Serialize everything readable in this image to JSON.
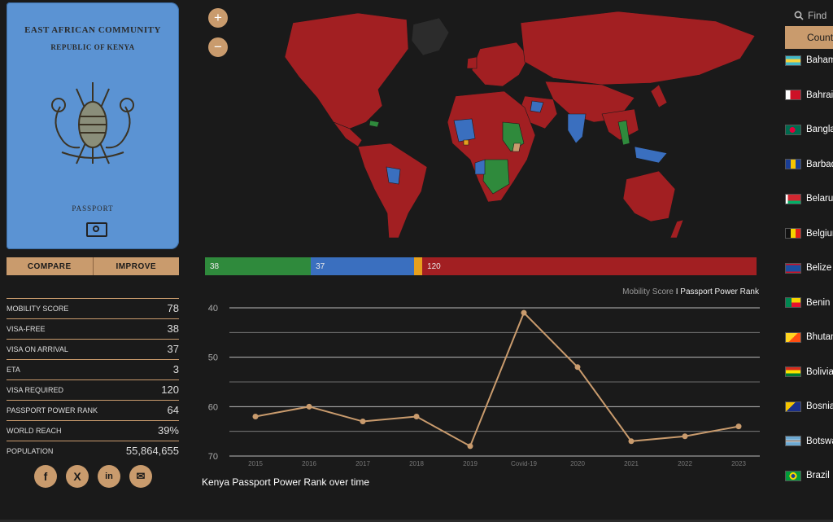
{
  "passport": {
    "line1": "EAST AFRICAN COMMUNITY",
    "line2": "REPUBLIC OF KENYA",
    "label": "PASSPORT",
    "cover_color": "#5b93d3"
  },
  "actions": {
    "compare": "COMPARE",
    "improve": "IMPROVE"
  },
  "stats": [
    {
      "label": "MOBILITY SCORE",
      "value": "78"
    },
    {
      "label": "VISA-FREE",
      "value": "38"
    },
    {
      "label": "VISA ON ARRIVAL",
      "value": "37"
    },
    {
      "label": "ETA",
      "value": "3"
    },
    {
      "label": "VISA REQUIRED",
      "value": "120"
    },
    {
      "label": "PASSPORT POWER RANK",
      "value": "64"
    },
    {
      "label": "WORLD REACH",
      "value": "39%"
    },
    {
      "label": "POPULATION",
      "value": "55,864,655"
    }
  ],
  "social": [
    "facebook-icon",
    "x-icon",
    "linkedin-icon",
    "email-icon"
  ],
  "zoom": {
    "in": "+",
    "out": "−"
  },
  "breakdown": [
    {
      "label": "38",
      "value": 38,
      "color": "#2f8a3c"
    },
    {
      "label": "37",
      "value": 37,
      "color": "#3a6fbf"
    },
    {
      "label": "",
      "value": 3,
      "color": "#e6a01e"
    },
    {
      "label": "120",
      "value": 120,
      "color": "#a21f22"
    }
  ],
  "legend": {
    "a": "Mobility Score",
    "sep": "I",
    "b": "Passport Power Rank"
  },
  "chart_data": {
    "type": "line",
    "x": [
      "2015",
      "2016",
      "2017",
      "2018",
      "2019",
      "Covid-19",
      "2020",
      "2021",
      "2022",
      "2023"
    ],
    "values": [
      62,
      60,
      63,
      62,
      68,
      41,
      52,
      67,
      66,
      64
    ],
    "ylim": [
      70,
      40
    ],
    "yticks": [
      "40",
      "50",
      "60",
      "70"
    ],
    "line_color": "#c99b6d",
    "title": "Kenya Passport Power Rank over time"
  },
  "search": {
    "placeholder": "Find"
  },
  "countries": {
    "header": "Countries",
    "items": [
      {
        "name": "Bahamas",
        "flag": "bahamas"
      },
      {
        "name": "Bahrain",
        "flag": "bahrain"
      },
      {
        "name": "Bangladesh",
        "flag": "bangladesh"
      },
      {
        "name": "Barbados",
        "flag": "barbados"
      },
      {
        "name": "Belarus",
        "flag": "belarus"
      },
      {
        "name": "Belgium",
        "flag": "belgium"
      },
      {
        "name": "Belize",
        "flag": "belize"
      },
      {
        "name": "Benin",
        "flag": "benin"
      },
      {
        "name": "Bhutan",
        "flag": "bhutan"
      },
      {
        "name": "Bolivia",
        "flag": "bolivia"
      },
      {
        "name": "Bosnia",
        "flag": "bosnia"
      },
      {
        "name": "Botswana",
        "flag": "botswana"
      },
      {
        "name": "Brazil",
        "flag": "brazil"
      }
    ]
  }
}
